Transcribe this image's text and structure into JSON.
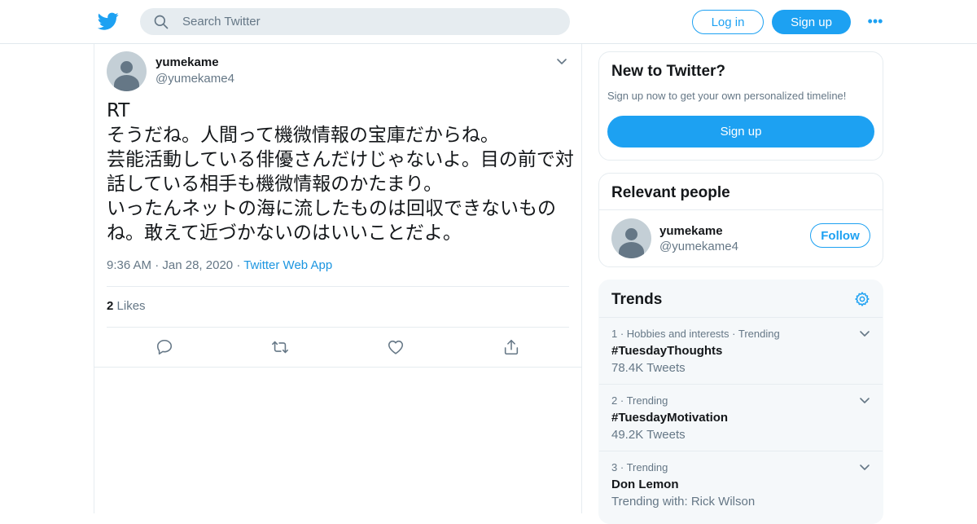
{
  "header": {
    "search_placeholder": "Search Twitter",
    "login_label": "Log in",
    "signup_label": "Sign up",
    "more_label": "•••"
  },
  "tweet": {
    "author_name": "yumekame",
    "author_handle": "@yumekame4",
    "text": "RT\nそうだね。人間って機微情報の宝庫だからね。\n芸能活動している俳優さんだけじゃないよ。目の前で対話している相手も機微情報のかたまり。\nいったんネットの海に流したものは回収できないものね。敢えて近づかないのはいいことだよ。",
    "time": "9:36 AM",
    "date": "Jan 28, 2020",
    "source": "Twitter Web App",
    "separator": "·",
    "likes_count": "2",
    "likes_label": "Likes"
  },
  "sidebar": {
    "new_title": "New to Twitter?",
    "new_subtitle": "Sign up now to get your own personalized timeline!",
    "new_signup_label": "Sign up",
    "people_title": "Relevant people",
    "person_name": "yumekame",
    "person_handle": "@yumekame4",
    "follow_label": "Follow",
    "trends_title": "Trends",
    "trends": [
      {
        "rank": "1",
        "context": "Hobbies and interests · Trending",
        "name": "#TuesdayThoughts",
        "count": "78.4K Tweets"
      },
      {
        "rank": "2",
        "context": "Trending",
        "name": "#TuesdayMotivation",
        "count": "49.2K Tweets"
      },
      {
        "rank": "3",
        "context": "Trending",
        "name": "Don Lemon",
        "count": "Trending with: Rick Wilson"
      }
    ]
  },
  "colors": {
    "accent": "#1da1f2",
    "secondary_text": "#657786",
    "link": "#1b95e0"
  }
}
